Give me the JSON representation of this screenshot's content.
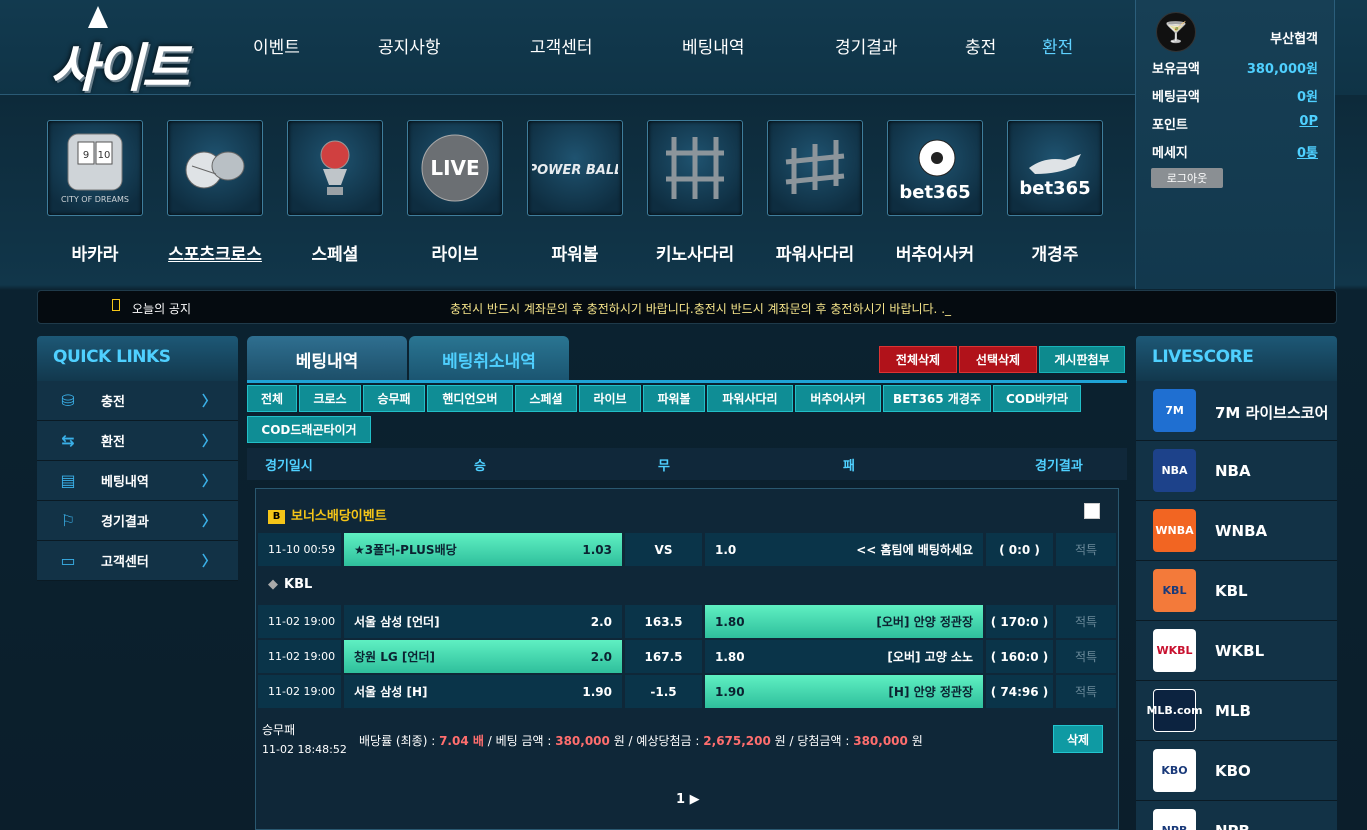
{
  "header": {
    "logo_text": "사이트",
    "nav": [
      "이벤트",
      "공지사항",
      "고객센터",
      "베팅내역",
      "경기결과",
      "충전",
      "환전"
    ],
    "active_nav": "환전"
  },
  "games": [
    {
      "label": "바카라",
      "tile": "CITY OF DREAMS",
      "icon": "card-icon"
    },
    {
      "label": "스포츠크로스",
      "tile": "",
      "icon": "ball-icon"
    },
    {
      "label": "스페셜",
      "tile": "",
      "icon": "trophy-icon"
    },
    {
      "label": "라이브",
      "tile": "LIVE",
      "icon": "live-icon"
    },
    {
      "label": "파워볼",
      "tile": "POWER BALL",
      "icon": "powerball-icon"
    },
    {
      "label": "키노사다리",
      "tile": "",
      "icon": "ladder-icon"
    },
    {
      "label": "파워사다리",
      "tile": "",
      "icon": "ladder-icon"
    },
    {
      "label": "버추어사커",
      "tile": "bet365",
      "icon": "soccer-icon"
    },
    {
      "label": "개경주",
      "tile": "bet365",
      "icon": "dog-icon"
    }
  ],
  "user": {
    "name": "부산협객",
    "rows": [
      {
        "label": "보유금액",
        "value": "380,000원"
      },
      {
        "label": "베팅금액",
        "value": "0원"
      },
      {
        "label": "포인트",
        "value": "0P"
      },
      {
        "label": "메세지",
        "value": "0통"
      }
    ],
    "logout": "로그아웃"
  },
  "notice": {
    "label": "오늘의 공지",
    "text": "충전시 반드시 계좌문의 후 충전하시기 바랍니다.충전시 반드시 계좌문의 후 충전하시기 바랍니다. ._"
  },
  "quick_links": {
    "title": "QUICK LINKS",
    "items": [
      {
        "label": "충전",
        "icon": "coins-icon"
      },
      {
        "label": "환전",
        "icon": "exchange-icon"
      },
      {
        "label": "베팅내역",
        "icon": "betting-icon"
      },
      {
        "label": "경기결과",
        "icon": "flag-icon"
      },
      {
        "label": "고객센터",
        "icon": "chat-icon"
      }
    ]
  },
  "tabs": [
    "베팅내역",
    "베팅취소내역"
  ],
  "actions": [
    "전체삭제",
    "선택삭제",
    "게시판첨부"
  ],
  "filters": [
    "전체",
    "크로스",
    "승무패",
    "핸디언오버",
    "스페셜",
    "라이브",
    "파워볼",
    "파워사다리",
    "버추어사커",
    "BET365 개경주",
    "COD바카라",
    "COD드래곤타이거"
  ],
  "columns": [
    "경기일시",
    "승",
    "무",
    "패",
    "경기결과"
  ],
  "bonus": {
    "badge": "B",
    "title": "보너스배당이벤트",
    "row": {
      "time": "11-10 00:59",
      "home": "★3폴더-PLUS배당",
      "home_odds": "1.03",
      "mid": "VS",
      "away_odds": "1.0",
      "away": "<< 홈팀에 배팅하세요",
      "score": "( 0:0 )",
      "result": "적특"
    }
  },
  "league": {
    "name": "KBL"
  },
  "bets": [
    {
      "time": "11-02 19:00",
      "home": "서울 삼성 [언더]",
      "home_odds": "2.0",
      "mid": "163.5",
      "away_odds": "1.80",
      "away": "[오버] 안양 정관장",
      "score": "( 170:0 )",
      "result": "적특",
      "selected": "away"
    },
    {
      "time": "11-02 19:00",
      "home": "창원 LG [언더]",
      "home_odds": "2.0",
      "mid": "167.5",
      "away_odds": "1.80",
      "away": "[오버] 고양 소노",
      "score": "( 160:0 )",
      "result": "적특",
      "selected": "home"
    },
    {
      "time": "11-02 19:00",
      "home": "서울 삼성 [H]",
      "home_odds": "1.90",
      "mid": "-1.5",
      "away_odds": "1.90",
      "away": "[H] 안양 정관장",
      "score": "( 74:96 )",
      "result": "적특",
      "selected": "away"
    }
  ],
  "summary": {
    "type": "승무패",
    "datetime": "11-02 18:48:52",
    "l1": "배당률 (최종) : ",
    "odds": "7.04 배",
    "l2": " / 베팅 금액 : ",
    "bet": "380,000",
    "l3": " 원 / 예상당첨금 : ",
    "expected": "2,675,200",
    "l4": " 원 / 당첨금액 : ",
    "win": "380,000",
    "l5": " 원",
    "delete": "삭제"
  },
  "pager": "1 ▶",
  "livescore": {
    "title": "LIVESCORE",
    "items": [
      {
        "name": "7M 라이브스코어",
        "logo": "7M",
        "color": "#1f6fd1"
      },
      {
        "name": "NBA",
        "logo": "NBA",
        "color": "#1d428a"
      },
      {
        "name": "WNBA",
        "logo": "WNBA",
        "color": "#f26522"
      },
      {
        "name": "KBL",
        "logo": "KBL",
        "color": "#f37a3a"
      },
      {
        "name": "WKBL",
        "logo": "WKBL",
        "color": "#ffffff"
      },
      {
        "name": "MLB",
        "logo": "MLB.com",
        "color": "#0c2340"
      },
      {
        "name": "KBO",
        "logo": "KBO",
        "color": "#ffffff"
      },
      {
        "name": "NPB",
        "logo": "NPB",
        "color": "#ffffff"
      }
    ]
  }
}
